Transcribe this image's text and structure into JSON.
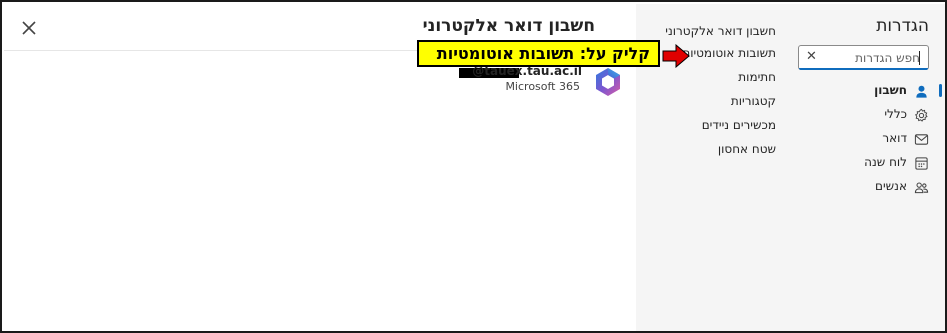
{
  "header": {
    "title": "חשבון דואר אלקטרוני",
    "close_icon": "close-icon"
  },
  "account": {
    "email": "@tauex.tau.ac.il",
    "provider": "Microsoft 365",
    "logo_icon": "microsoft-365-logo"
  },
  "middle_menu": {
    "items": [
      {
        "label": "חשבון דואר אלקטרוני"
      },
      {
        "label": "תשובות אוטומטיות"
      },
      {
        "label": "חתימות"
      },
      {
        "label": "קטגוריות"
      },
      {
        "label": "מכשירים ניידים"
      },
      {
        "label": "שטח אחסון"
      }
    ]
  },
  "sidebar": {
    "title": "הגדרות",
    "search": {
      "placeholder": "חפש הגדרות",
      "value": "",
      "clear_icon": "close-icon"
    },
    "items": [
      {
        "label": "חשבון",
        "icon": "person-icon",
        "active": true
      },
      {
        "label": "כללי",
        "icon": "gear-icon",
        "active": false
      },
      {
        "label": "דואר",
        "icon": "mail-icon",
        "active": false
      },
      {
        "label": "לוח שנה",
        "icon": "calendar-icon",
        "active": false
      },
      {
        "label": "אנשים",
        "icon": "people-icon",
        "active": false
      }
    ]
  },
  "annotation": {
    "text": "קליק על: תשובות אוטומטיות",
    "background": "#ffff00",
    "arrow_color": "#e00000"
  },
  "colors": {
    "accent": "#0f6cbd",
    "sidebar_bg": "#f5f5f5"
  }
}
